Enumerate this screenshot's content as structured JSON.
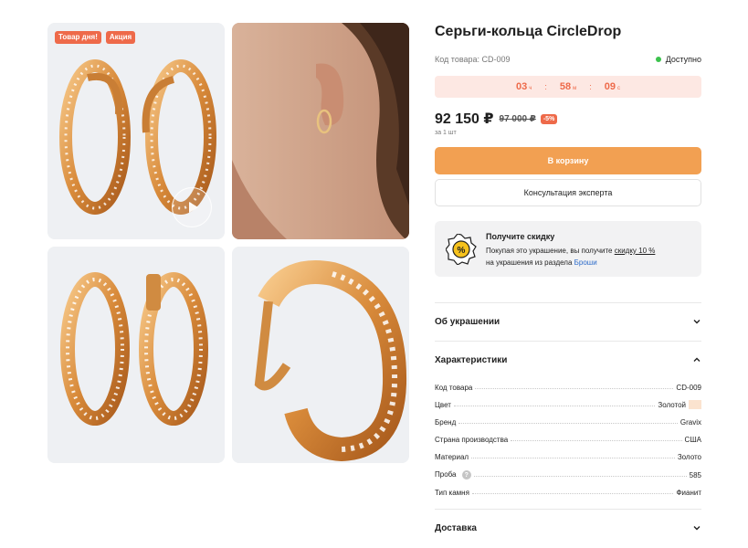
{
  "gallery": {
    "badges": [
      "Товар дня!",
      "Акция"
    ]
  },
  "product": {
    "title": "Серьги-кольца CircleDrop",
    "sku_text": "Код товара: CD-009",
    "availability": "Доступно",
    "timer": {
      "hours": "03",
      "hours_unit": "ч",
      "minutes": "58",
      "minutes_unit": "м",
      "seconds": "09",
      "seconds_unit": "с",
      "separator": ":"
    },
    "price": "92 150 ₽",
    "old_price": "97 000 ₽",
    "discount": "-5%",
    "per_unit": "за 1 шт",
    "cart_button": "В корзину",
    "consult_button": "Консультация эксперта"
  },
  "promo": {
    "title": "Получите скидку",
    "text_before": "Покупая это украшение, вы получите ",
    "discount_link": "скидку 10 %",
    "text_middle": "на украшения из раздела ",
    "category_link": "Броши"
  },
  "sections": {
    "about": "Об украшении",
    "specs": "Характеристики",
    "delivery": "Доставка"
  },
  "specs": [
    {
      "key": "Код товара",
      "value": "CD-009"
    },
    {
      "key": "Цвет",
      "value": "Золотой"
    },
    {
      "key": "Бренд",
      "value": "Gravix"
    },
    {
      "key": "Страна производства",
      "value": "США"
    },
    {
      "key": "Материал",
      "value": "Золото"
    },
    {
      "key": "Проба",
      "value": "585",
      "help": "?"
    },
    {
      "key": "Тип камня",
      "value": "Фианит"
    }
  ],
  "colors": {
    "accent": "#f2a052",
    "badge": "#ee6a4a",
    "timer_bg": "#fde8e3",
    "available": "#3cc24d",
    "link": "#2c6bc9",
    "gold_swatch": "#fbe3cf"
  }
}
